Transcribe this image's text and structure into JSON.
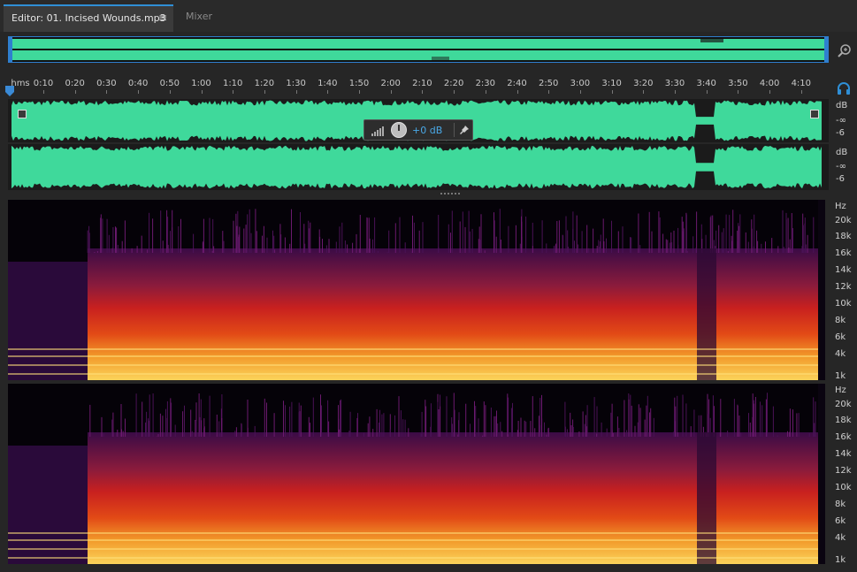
{
  "tabs": [
    {
      "label": "Editor: 01. Incised Wounds.mp3",
      "active": true
    },
    {
      "label": "Mixer",
      "active": false
    }
  ],
  "tab_menu_glyph": "≡",
  "timeline": {
    "unit_label": "hms",
    "ticks": [
      "0:10",
      "0:20",
      "0:30",
      "0:40",
      "0:50",
      "1:00",
      "1:10",
      "1:20",
      "1:30",
      "1:40",
      "1:50",
      "2:00",
      "2:10",
      "2:20",
      "2:30",
      "2:40",
      "2:50",
      "3:00",
      "3:10",
      "3:20",
      "3:30",
      "3:40",
      "3:50",
      "4:00",
      "4:10"
    ]
  },
  "db_scale": {
    "unit": "dB",
    "labels": [
      "-∞",
      "-6"
    ]
  },
  "hud": {
    "volume": "+0 dB"
  },
  "hz_scale": {
    "unit": "Hz",
    "labels": [
      "20k",
      "18k",
      "16k",
      "14k",
      "12k",
      "10k",
      "8k",
      "6k",
      "4k",
      "1k"
    ]
  },
  "colors": {
    "waveform": "#3fd99b",
    "accent": "#2f8fd6",
    "background": "#262626"
  },
  "icons": {
    "zoom": "zoom-icon",
    "monitor": "headphones-icon",
    "pin": "pin-icon",
    "meter": "level-meter-icon"
  }
}
